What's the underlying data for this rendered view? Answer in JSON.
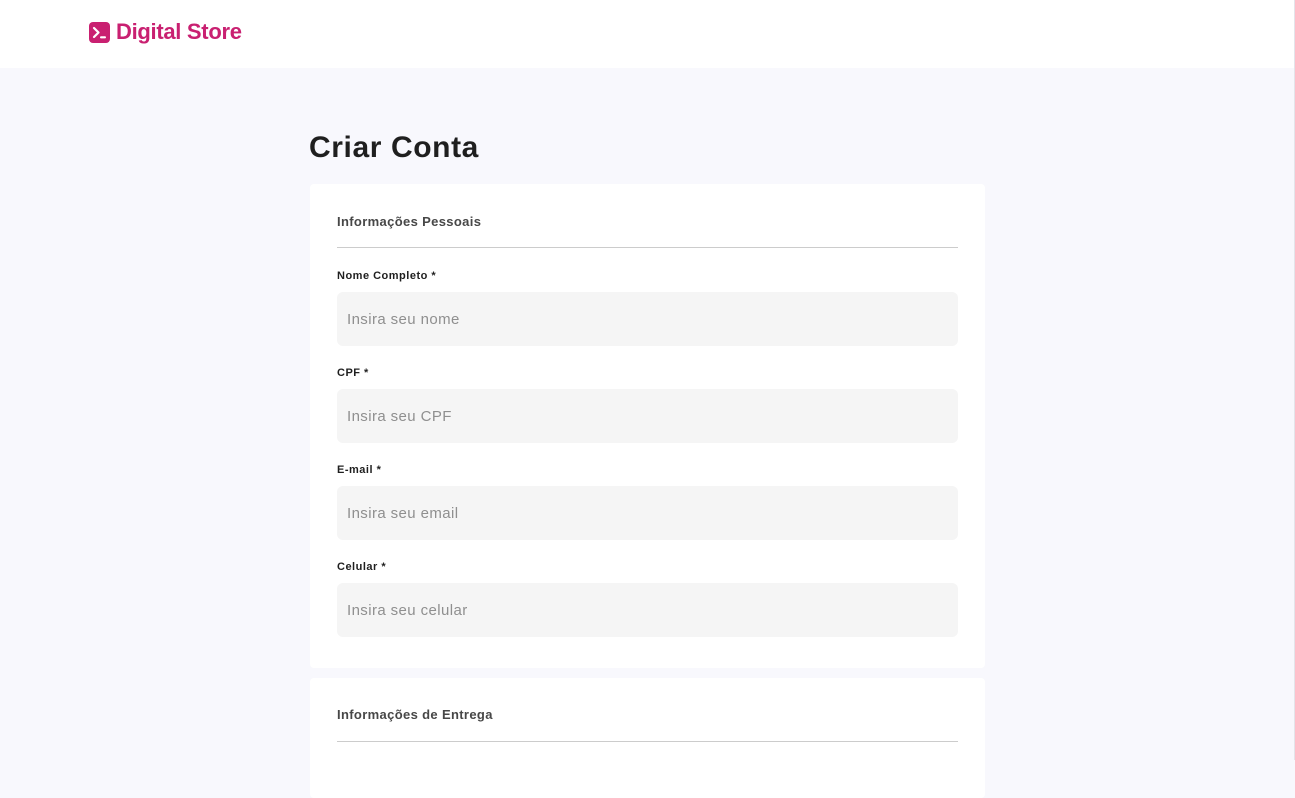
{
  "header": {
    "logo_text": "Digital Store",
    "logo_icon": "terminal-icon",
    "brand_color": "#c92071"
  },
  "page": {
    "title": "Criar Conta"
  },
  "personal": {
    "section_title": "Informações Pessoais",
    "fields": [
      {
        "label": "Nome Completo *",
        "placeholder": "Insira seu nome",
        "value": ""
      },
      {
        "label": "CPF *",
        "placeholder": "Insira seu CPF",
        "value": ""
      },
      {
        "label": "E-mail *",
        "placeholder": "Insira seu email",
        "value": ""
      },
      {
        "label": "Celular *",
        "placeholder": "Insira seu celular",
        "value": ""
      }
    ]
  },
  "delivery": {
    "section_title": "Informações de Entrega"
  },
  "colors": {
    "page_background": "#f8f8fd",
    "card_background": "#ffffff",
    "input_background": "#f5f5f5"
  }
}
